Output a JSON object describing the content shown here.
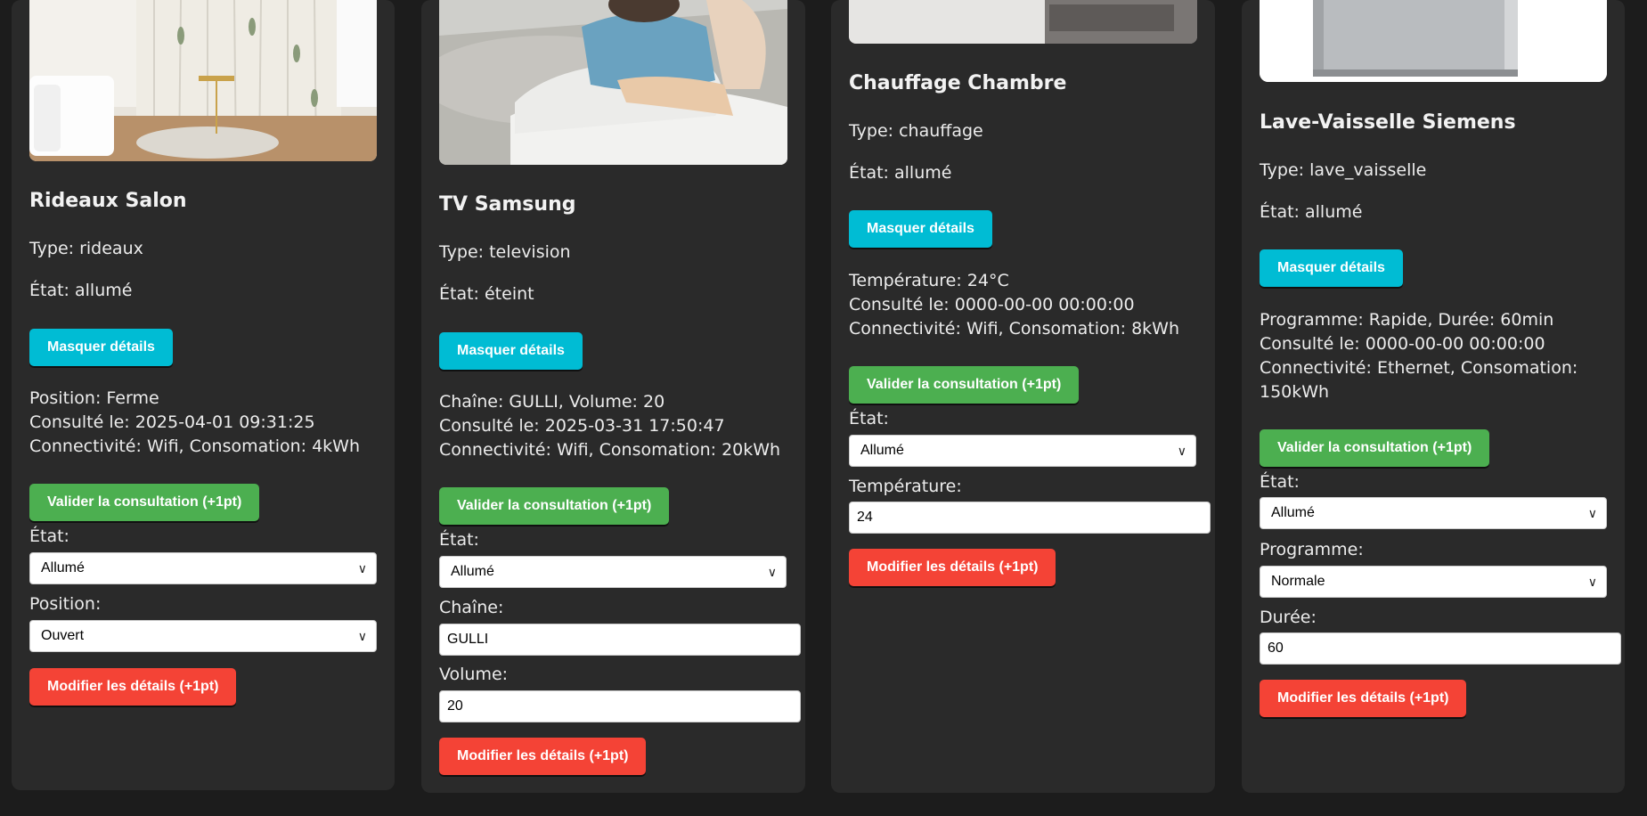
{
  "buttons": {
    "hide": "Masquer détails",
    "validate": "Valider la consultation (+1pt)",
    "modify": "Modifier les détails (+1pt)"
  },
  "labels": {
    "etat": "État:",
    "position": "Position:",
    "chaine": "Chaîne:",
    "volume": "Volume:",
    "temperature": "Température:",
    "programme": "Programme:",
    "duree": "Durée:"
  },
  "devices": [
    {
      "name": "Rideaux Salon",
      "type": "Type: rideaux",
      "state": "État: allumé",
      "details": [
        "Position: Ferme",
        "Consulté le: 2025-04-01 09:31:25",
        "Connectivité: Wifi, Consomation: 4kWh"
      ],
      "form": {
        "etat": "Allumé",
        "position": "Ouvert"
      }
    },
    {
      "name": "TV Samsung",
      "type": "Type: television",
      "state": "État: éteint",
      "details": [
        "Chaîne: GULLI, Volume: 20",
        "Consulté le: 2025-03-31 17:50:47",
        "Connectivité: Wifi, Consomation: 20kWh"
      ],
      "form": {
        "etat": "Allumé",
        "chaine": "GULLI",
        "volume": "20"
      }
    },
    {
      "name": "Chauffage Chambre",
      "type": "Type: chauffage",
      "state": "État: allumé",
      "details": [
        "Température: 24°C",
        "Consulté le: 0000-00-00 00:00:00",
        "Connectivité: Wifi, Consomation: 8kWh"
      ],
      "form": {
        "etat": "Allumé",
        "temperature": "24"
      }
    },
    {
      "name": "Lave-Vaisselle Siemens",
      "type": "Type: lave_vaisselle",
      "state": "État: allumé",
      "details": [
        "Programme: Rapide, Durée: 60min",
        "Consulté le: 0000-00-00 00:00:00",
        "Connectivité: Ethernet, Consomation:",
        "150kWh"
      ],
      "form": {
        "etat": "Allumé",
        "programme": "Normale",
        "duree": "60"
      }
    }
  ],
  "colors": {
    "cyan": "#00bcd4",
    "green": "#4caf50",
    "red": "#f44336",
    "card": "#2a2a2a",
    "page": "#1c1c1c"
  },
  "icons": {
    "select": "chevron-down-icon"
  }
}
